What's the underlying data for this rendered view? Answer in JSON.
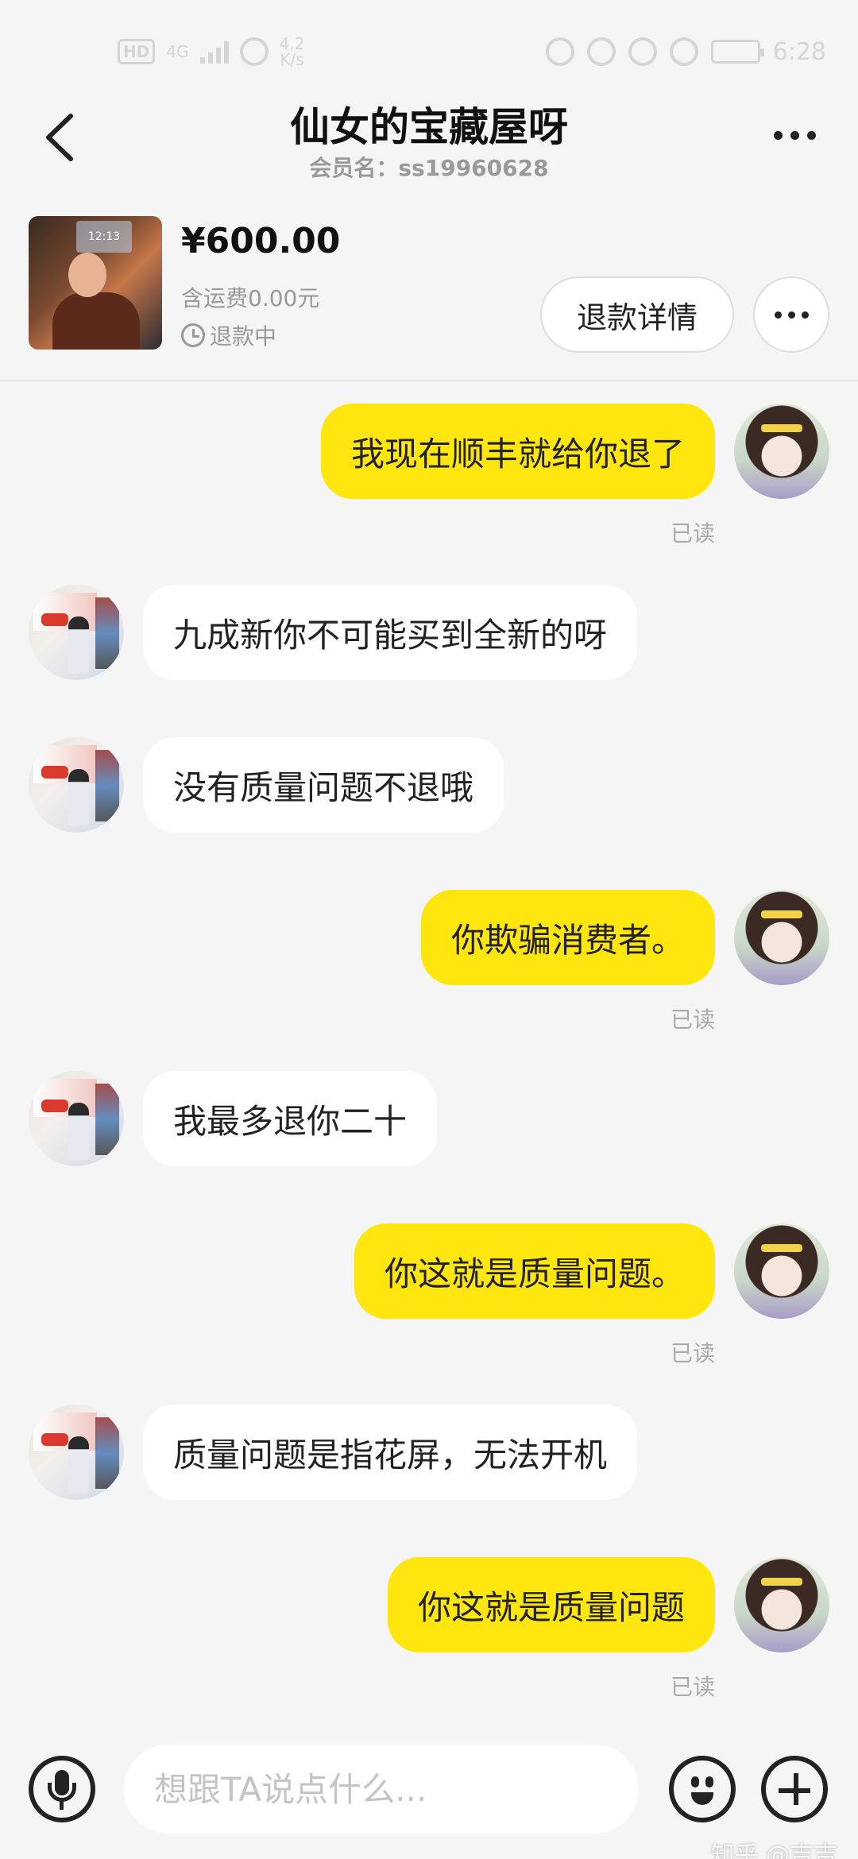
{
  "status_bar": {
    "hd": "HD",
    "network": "4G",
    "speed_value": "4.2",
    "speed_unit": "K/s",
    "time": "6:28"
  },
  "header": {
    "title": "仙女的宝藏屋呀",
    "member_name": "会员名：ss19960628",
    "back_icon": "chevron-left-icon",
    "more_icon": "more-dots-icon"
  },
  "product": {
    "price": "¥600.00",
    "shipping": "含运费0.00元",
    "status": "退款中",
    "refund_button": "退款详情",
    "thumbnail_text": "12:13"
  },
  "messages": [
    {
      "side": "me",
      "text": "我现在顺丰就给你退了",
      "read": "已读"
    },
    {
      "side": "them",
      "text": "九成新你不可能买到全新的呀"
    },
    {
      "side": "them",
      "text": "没有质量问题不退哦"
    },
    {
      "side": "me",
      "text": "你欺骗消费者。",
      "read": "已读"
    },
    {
      "side": "them",
      "text": "我最多退你二十"
    },
    {
      "side": "me",
      "text": "你这就是质量问题。",
      "read": "已读"
    },
    {
      "side": "them",
      "text": "质量问题是指花屏，无法开机"
    },
    {
      "side": "me",
      "text": "你这就是质量问题",
      "read": "已读"
    }
  ],
  "input_bar": {
    "placeholder": "想跟TA说点什么...",
    "mic_icon": "microphone-icon",
    "emoji_icon": "emoji-icon",
    "plus_icon": "plus-icon"
  },
  "watermark": "知乎 @吉吉",
  "colors": {
    "my_bubble": "#ffe60f",
    "their_bubble": "#ffffff",
    "background": "#f5f5f5"
  }
}
